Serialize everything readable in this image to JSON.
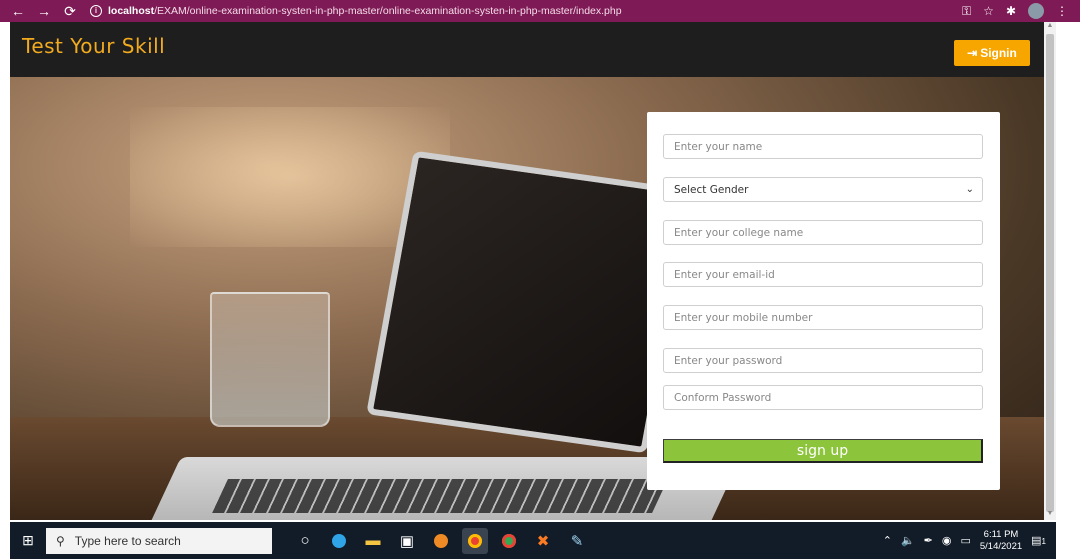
{
  "browser": {
    "url_host": "localhost",
    "url_path": "/EXAM/online-examination-systen-in-php-master/online-examination-systen-in-php-master/index.php"
  },
  "header": {
    "title": "Test Your Skill",
    "signin_label": "Signin"
  },
  "form": {
    "name_placeholder": "Enter your name",
    "gender_selected": "Select Gender",
    "college_placeholder": "Enter your college name",
    "email_placeholder": "Enter your email-id",
    "mobile_placeholder": "Enter your mobile number",
    "password_placeholder": "Enter your password",
    "confirm_placeholder": "Conform Password",
    "submit_label": "sign up"
  },
  "taskbar": {
    "search_placeholder": "Type here to search",
    "time": "6:11 PM",
    "date": "5/14/2021",
    "notification_count": "1"
  },
  "colors": {
    "chrome_bar": "#7e1a55",
    "header_bg": "#1e1e1e",
    "title_color": "#f2ab1e",
    "signin_bg": "#f7a600",
    "submit_bg": "#8cc43c",
    "taskbar_bg": "#121c28"
  }
}
